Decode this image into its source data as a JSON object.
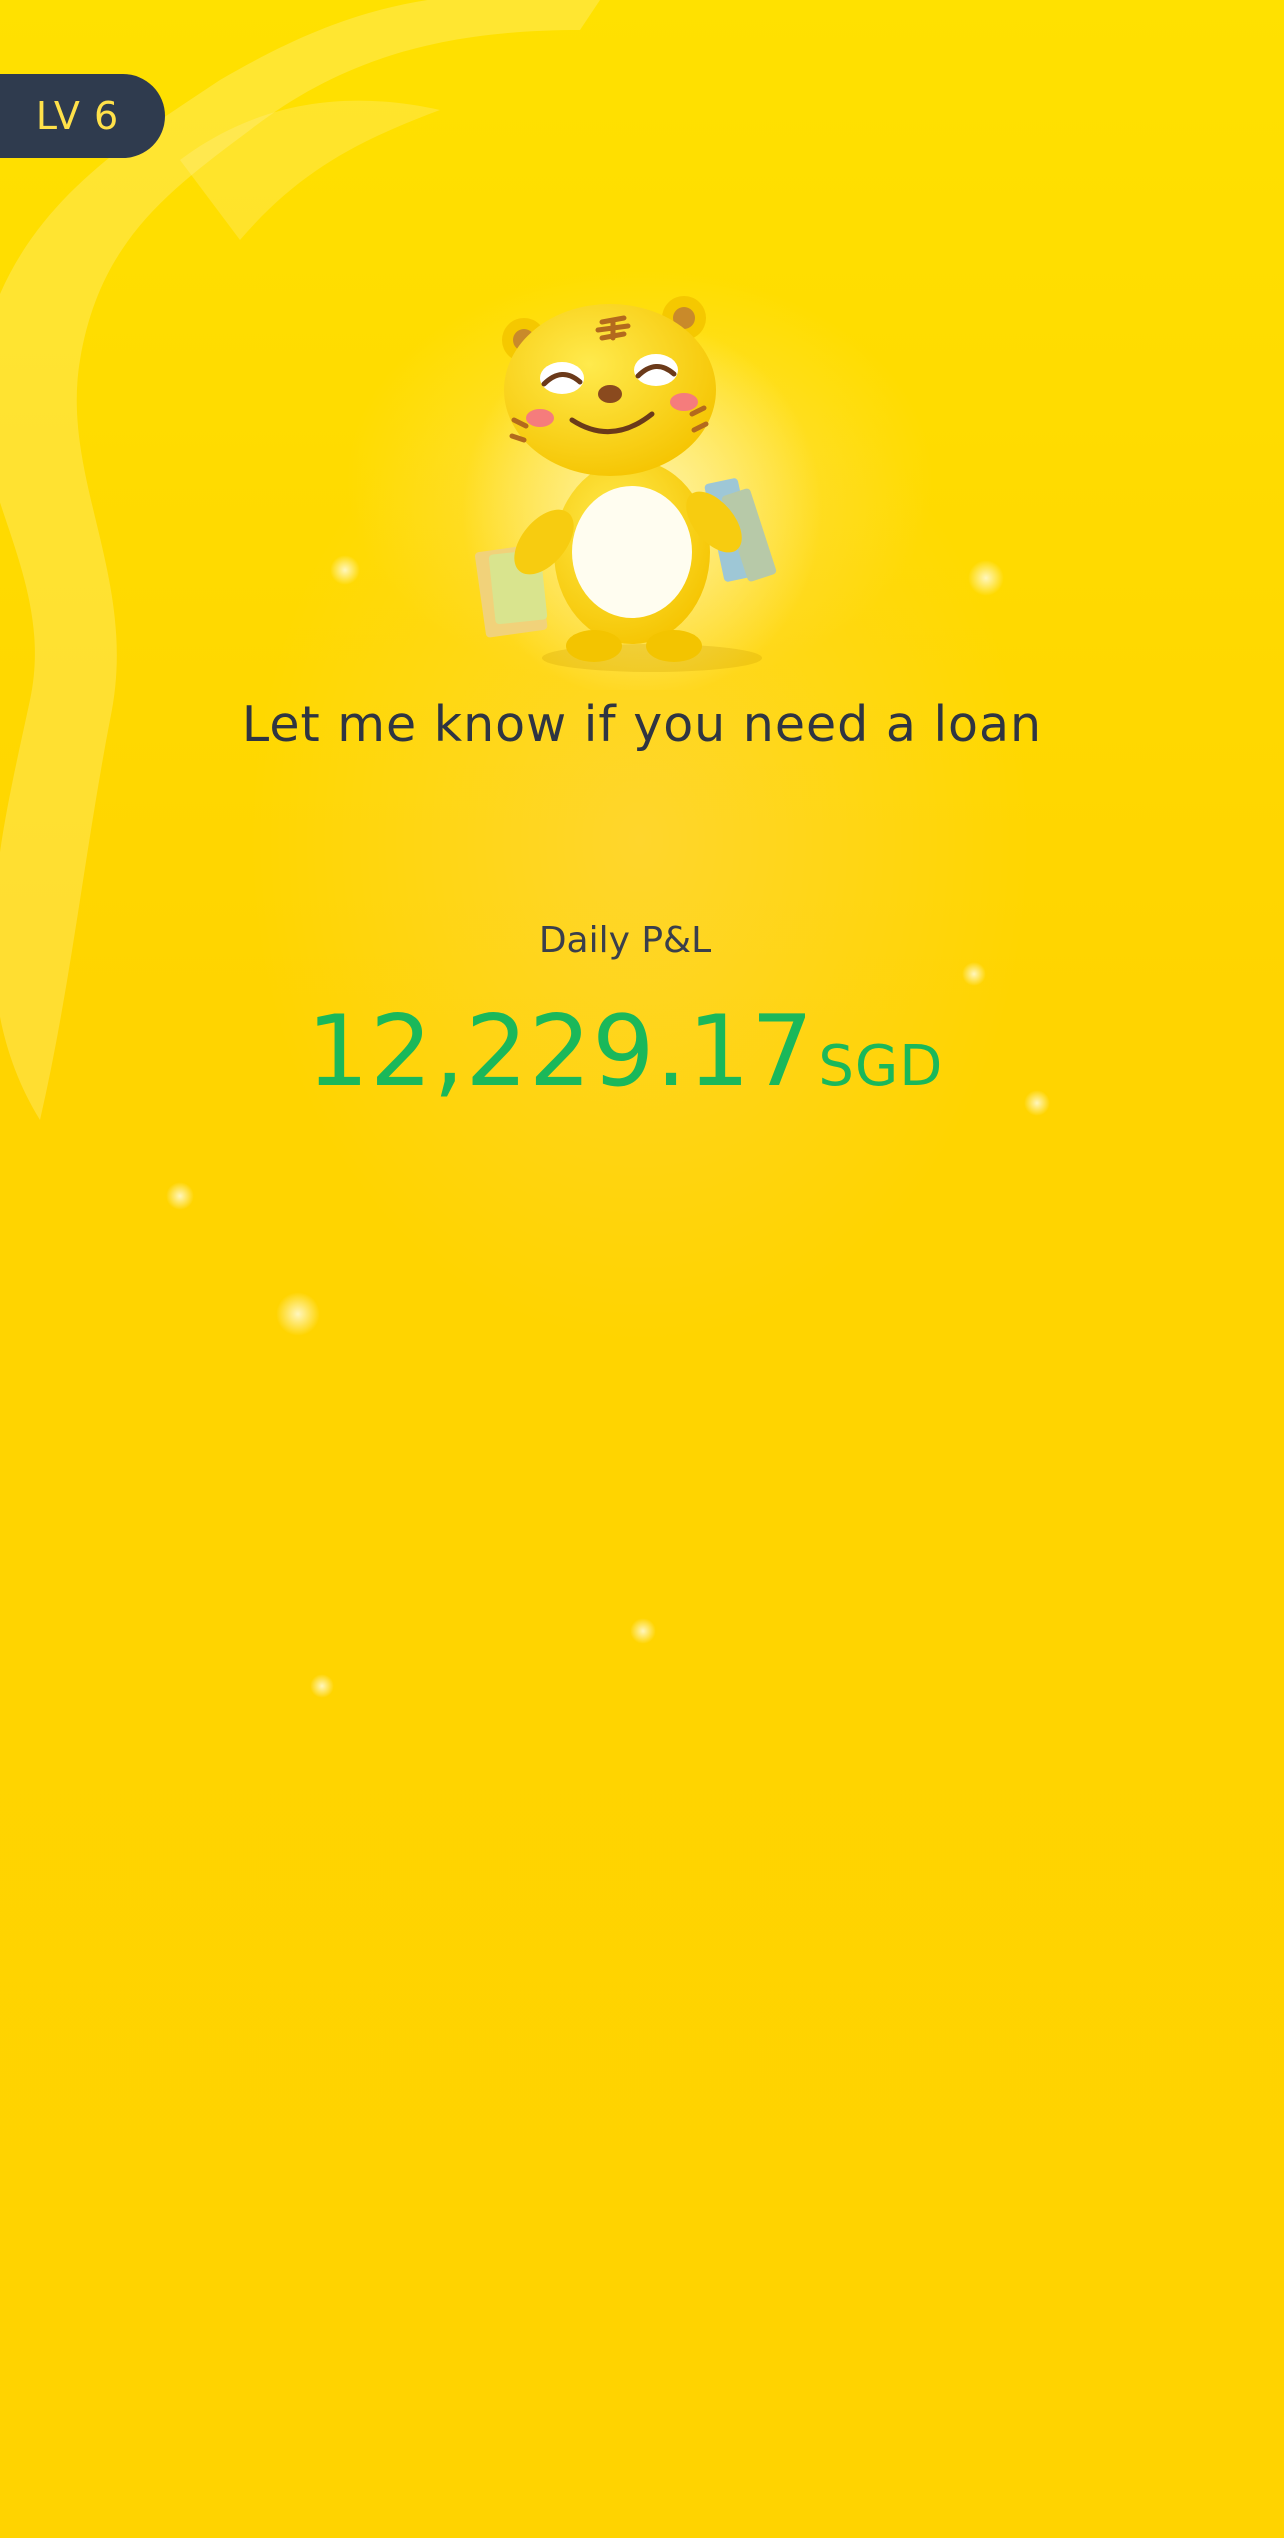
{
  "level_badge": {
    "label": "LV 6"
  },
  "headline": "Let me know if you need a loan",
  "daily_pl": {
    "label": "Daily P&L",
    "value": "12,229.17",
    "currency": "SGD"
  },
  "colors": {
    "background": "#ffd800",
    "badge_bg": "#2f3b4e",
    "badge_text": "#ffe14a",
    "profit_green": "#1ab85a",
    "text_dark": "#2f3542"
  },
  "mascot": {
    "icon": "tiger-mascot-with-shopping-bags"
  }
}
